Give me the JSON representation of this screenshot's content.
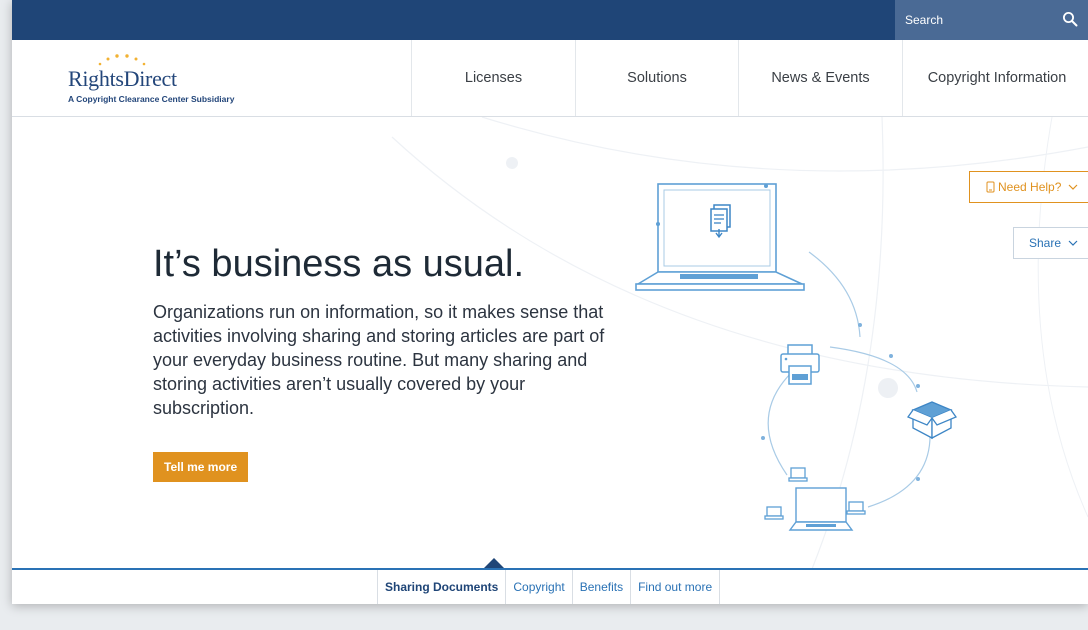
{
  "search": {
    "placeholder": "Search"
  },
  "brand": {
    "name": "RightsDirect",
    "tagline": "A Copyright Clearance Center Subsidiary",
    "colors": {
      "navy": "#1f4577",
      "orange": "#e0921f",
      "link": "#2a72b5"
    }
  },
  "nav": {
    "items": [
      {
        "label": "Licenses"
      },
      {
        "label": "Solutions"
      },
      {
        "label": "News & Events"
      },
      {
        "label": "Copyright Information"
      }
    ]
  },
  "hero": {
    "title": "It’s business as usual.",
    "body": "Organizations run on information, so it makes sense that activities involving sharing and storing articles are part of your everyday business routine. But many sharing and storing activities aren’t usually covered by your subscription.",
    "cta_label": "Tell me more"
  },
  "help": {
    "need_help_label": "Need Help?",
    "share_label": "Share"
  },
  "tabs": [
    {
      "label": "Sharing Documents",
      "active": true
    },
    {
      "label": "Copyright",
      "active": false
    },
    {
      "label": "Benefits",
      "active": false
    },
    {
      "label": "Find out more",
      "active": false
    }
  ],
  "icons": [
    "search-icon",
    "document-icon",
    "laptop-icon",
    "printer-icon",
    "box-icon",
    "phone-icon",
    "chevron-down-icon"
  ]
}
